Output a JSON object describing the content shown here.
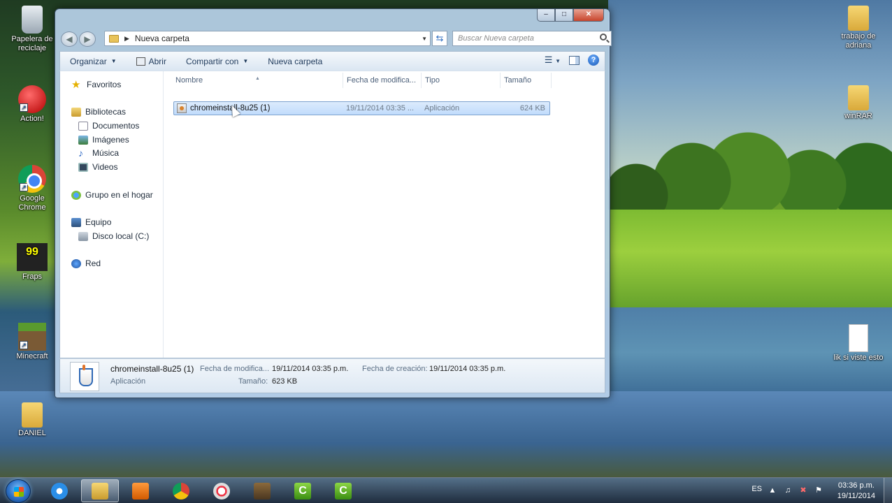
{
  "desktop": {
    "icons": [
      {
        "label": "Papelera de reciclaje",
        "icon": "recycle-bin-icon"
      },
      {
        "label": "Action!",
        "icon": "action-icon"
      },
      {
        "label": "Google Chrome",
        "icon": "chrome-icon"
      },
      {
        "label": "Fraps",
        "icon": "fraps-icon",
        "badge": "99"
      },
      {
        "label": "Minecraft",
        "icon": "minecraft-icon"
      },
      {
        "label": "DANIEL",
        "icon": "folder-icon"
      },
      {
        "label": "trabajo de adriana",
        "icon": "folder-icon"
      },
      {
        "label": "winRAR",
        "icon": "folder-icon"
      },
      {
        "label": "lik si viste esto",
        "icon": "text-document-icon"
      }
    ]
  },
  "window": {
    "buttons": {
      "minimize": "‒",
      "maximize": "□",
      "close": "✕"
    },
    "address": {
      "path": "Nueva carpeta"
    },
    "search": {
      "placeholder": "Buscar Nueva carpeta"
    },
    "toolbar": {
      "organize": "Organizar",
      "open": "Abrir",
      "share": "Compartir con",
      "new_folder": "Nueva carpeta"
    },
    "nav": {
      "favorites": "Favoritos",
      "libraries": "Bibliotecas",
      "documents": "Documentos",
      "images": "Imágenes",
      "music": "Música",
      "videos": "Videos",
      "homegroup": "Grupo en el hogar",
      "computer": "Equipo",
      "local_disk": "Disco local (C:)",
      "network": "Red"
    },
    "columns": {
      "name": "Nombre",
      "date": "Fecha de modifica...",
      "type": "Tipo",
      "size": "Tamaño"
    },
    "files": [
      {
        "name": "chromeinstall-8u25 (1)",
        "date": "19/11/2014 03:35 ...",
        "type": "Aplicación",
        "size": "624 KB",
        "selected": true
      }
    ],
    "details": {
      "name": "chromeinstall-8u25 (1)",
      "type": "Aplicación",
      "modified_label": "Fecha de modifica...",
      "modified_value": "19/11/2014 03:35 p.m.",
      "size_label": "Tamaño:",
      "size_value": "623 KB",
      "created_label": "Fecha de creación:",
      "created_value": "19/11/2014 03:35 p.m."
    }
  },
  "taskbar": {
    "apps": [
      {
        "name": "internet-explorer",
        "active": false
      },
      {
        "name": "file-explorer",
        "active": true
      },
      {
        "name": "media-player",
        "active": false
      },
      {
        "name": "chrome",
        "active": false
      },
      {
        "name": "paint",
        "active": false
      },
      {
        "name": "minecraft",
        "active": false
      },
      {
        "name": "camtasia",
        "active": false
      },
      {
        "name": "camtasia-recorder",
        "active": false
      }
    ],
    "tray": {
      "language": "ES",
      "time": "03:36 p.m.",
      "date": "19/11/2014"
    }
  }
}
